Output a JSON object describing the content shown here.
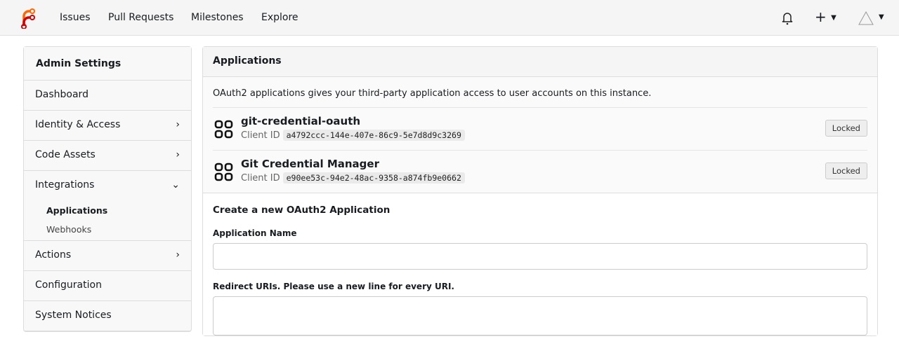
{
  "nav": {
    "items": [
      "Issues",
      "Pull Requests",
      "Milestones",
      "Explore"
    ]
  },
  "sidebar": {
    "title": "Admin Settings",
    "items": [
      {
        "label": "Dashboard",
        "chevron": ""
      },
      {
        "label": "Identity & Access",
        "chevron": "›"
      },
      {
        "label": "Code Assets",
        "chevron": "›"
      },
      {
        "label": "Integrations",
        "chevron": "⌄"
      }
    ],
    "subitems": [
      "Applications",
      "Webhooks"
    ],
    "items2": [
      {
        "label": "Actions",
        "chevron": "›"
      },
      {
        "label": "Configuration",
        "chevron": ""
      },
      {
        "label": "System Notices",
        "chevron": ""
      }
    ]
  },
  "main": {
    "title": "Applications",
    "description": "OAuth2 applications gives your third-party application access to user accounts on this instance.",
    "apps": [
      {
        "name": "git-credential-oauth",
        "client_id_label": "Client ID",
        "client_id": "a4792ccc-144e-407e-86c9-5e7d8d9c3269",
        "badge": "Locked"
      },
      {
        "name": "Git Credential Manager",
        "client_id_label": "Client ID",
        "client_id": "e90ee53c-94e2-48ac-9358-a874fb9e0662",
        "badge": "Locked"
      }
    ],
    "form": {
      "title": "Create a new OAuth2 Application",
      "name_label": "Application Name",
      "name_value": "",
      "redirect_label": "Redirect URIs. Please use a new line for every URI.",
      "redirect_value": ""
    }
  }
}
